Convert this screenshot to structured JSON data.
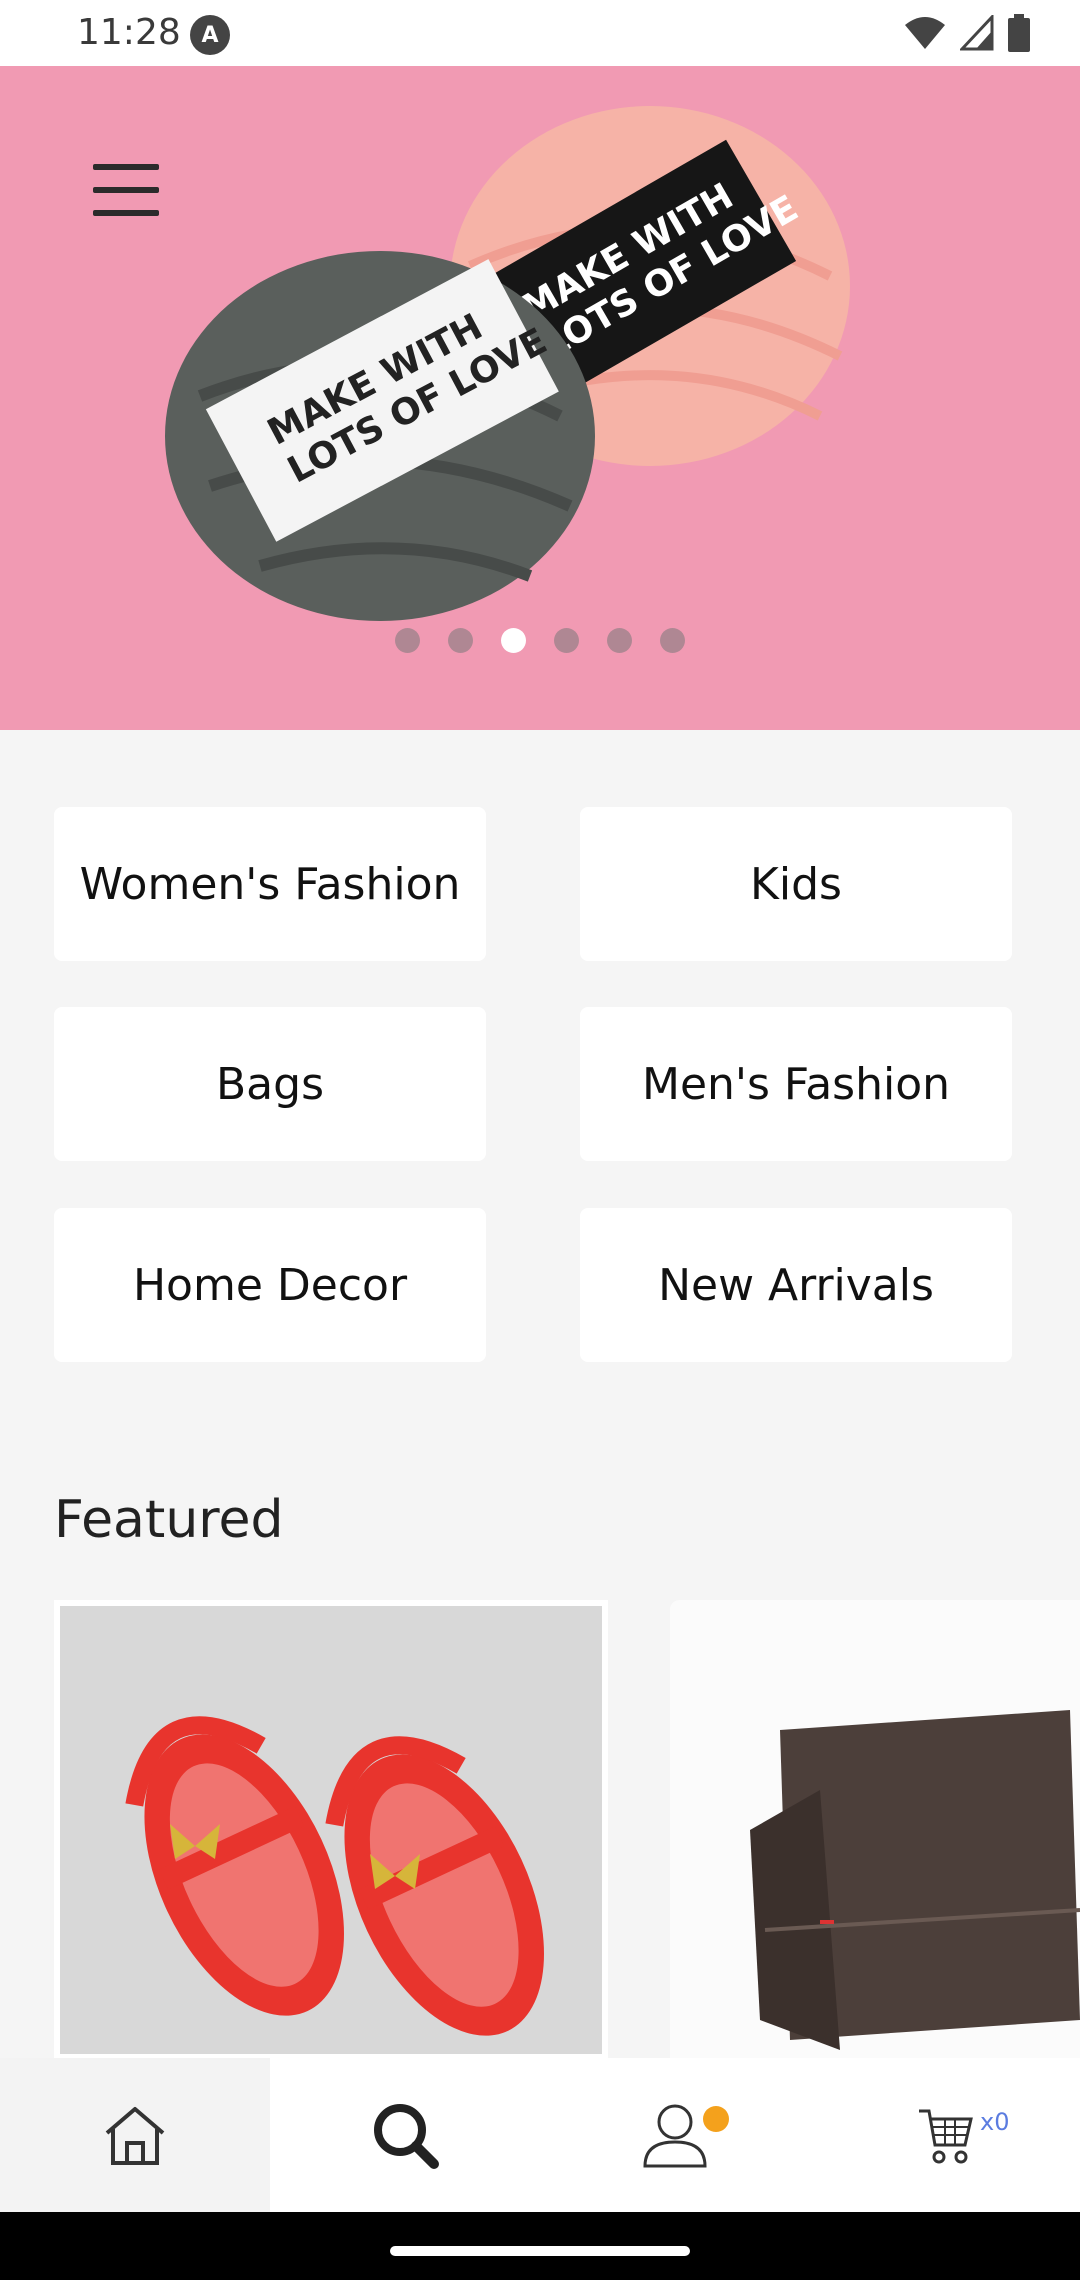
{
  "status_bar": {
    "time": "11:28",
    "app_icon": "letter-a-icon",
    "icons": [
      "wifi-icon",
      "signal-icon",
      "battery-icon"
    ]
  },
  "hero": {
    "slide_count": 6,
    "active_slide": 3,
    "yarn_label_text": "MAKE WITH LOTS OF LOVE",
    "background_color": "#f19ab3"
  },
  "categories": [
    {
      "label": "Women's Fashion"
    },
    {
      "label": "Kids"
    },
    {
      "label": "Bags"
    },
    {
      "label": "Men's Fashion"
    },
    {
      "label": "Home Decor"
    },
    {
      "label": "New Arrivals"
    }
  ],
  "featured": {
    "title": "Featured",
    "products": [
      {
        "image": "red-kids-sandals"
      },
      {
        "image": "brown-wallet"
      }
    ]
  },
  "bottom_nav": {
    "items": [
      "home-icon",
      "search-icon",
      "account-icon",
      "cart-icon"
    ],
    "cart_count": "x0",
    "accent": "#f4a11c"
  }
}
